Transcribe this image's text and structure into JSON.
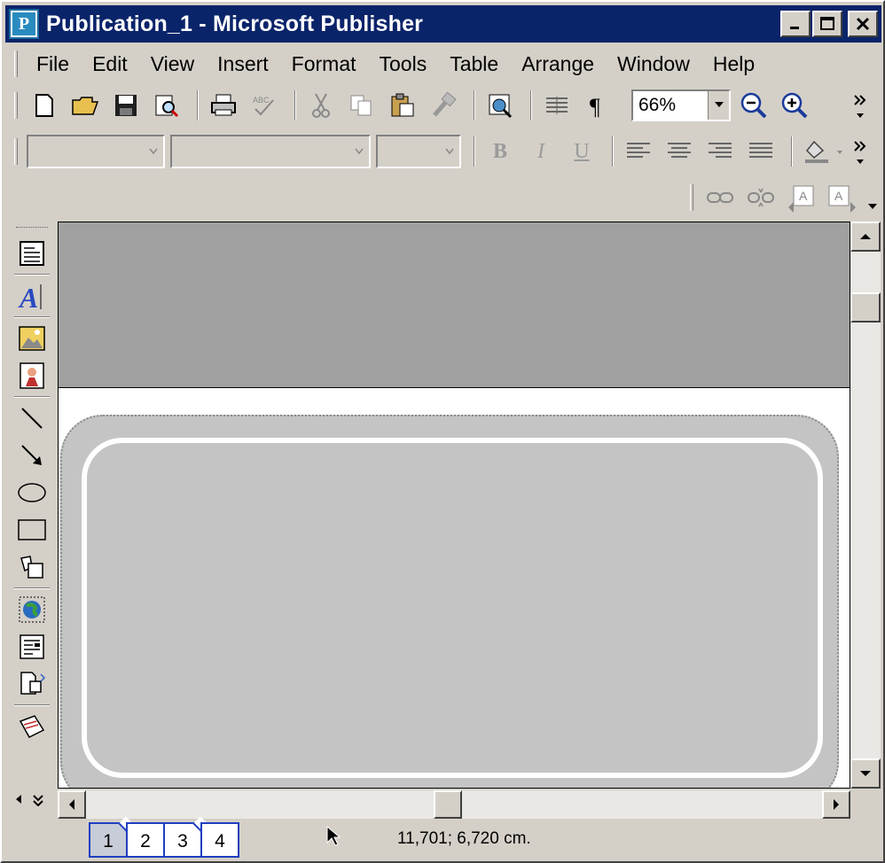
{
  "window": {
    "title": "Publication_1 - Microsoft Publisher",
    "title_color": "#0a246a"
  },
  "menu": {
    "items": [
      "File",
      "Edit",
      "View",
      "Insert",
      "Format",
      "Tools",
      "Table",
      "Arrange",
      "Window",
      "Help"
    ]
  },
  "standard_toolbar": {
    "zoom_value": "66%",
    "icons": [
      "new-icon",
      "open-icon",
      "save-icon",
      "print-preview-icon",
      "print-icon",
      "spelling-icon",
      "cut-icon",
      "copy-icon",
      "paste-icon",
      "format-painter-icon",
      "web-preview-icon",
      "columns-icon",
      "paragraph-mark-icon",
      "zoom-out-icon",
      "zoom-in-icon"
    ]
  },
  "formatting_toolbar": {
    "bold": "B",
    "italic": "I",
    "underline": "U"
  },
  "pages": {
    "tabs": [
      "1",
      "2",
      "3",
      "4"
    ],
    "active": "1"
  },
  "status": {
    "coordinates": "11,701; 6,720 cm."
  }
}
